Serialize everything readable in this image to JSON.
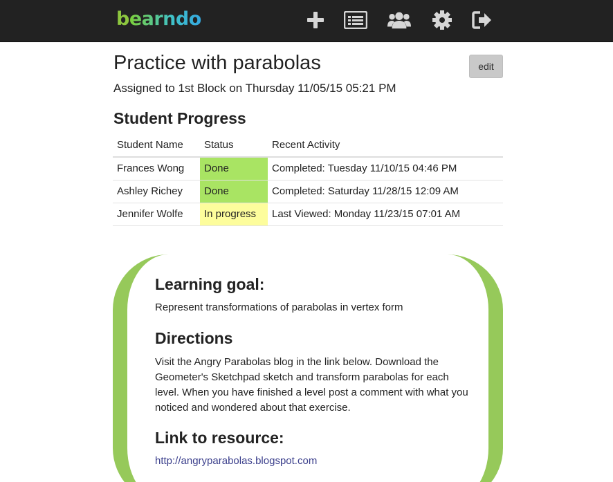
{
  "brand": {
    "logo_first": "b",
    "logo_rest": "earndo"
  },
  "nav": {
    "icons": [
      "add-icon",
      "list-icon",
      "users-icon",
      "settings-icon",
      "logout-icon"
    ]
  },
  "assignment": {
    "title": "Practice with parabolas",
    "edit_label": "edit",
    "assigned_text": "Assigned to 1st Block on Thursday 11/05/15 05:21 PM"
  },
  "progress": {
    "heading": "Student Progress",
    "columns": [
      "Student Name",
      "Status",
      "Recent Activity"
    ],
    "rows": [
      {
        "name": "Frances Wong",
        "status": "Done",
        "activity": "Completed: Tuesday 11/10/15 04:46 PM"
      },
      {
        "name": "Ashley Richey",
        "status": "Done",
        "activity": "Completed: Saturday 11/28/15 12:09 AM"
      },
      {
        "name": "Jennifer Wolfe",
        "status": "In progress",
        "activity": "Last Viewed: Monday 11/23/15 07:01 AM"
      }
    ]
  },
  "details": {
    "goal_heading": "Learning goal:",
    "goal_text": "Represent transformations of parabolas in vertex form",
    "directions_heading": "Directions",
    "directions_text": "Visit the Angry Parabolas blog in the link below. Download the Geometer's Sketchpad sketch and transform parabolas for each level. When you have finished a level post a comment with what you noticed and wondered about that exercise.",
    "link_heading": "Link to resource:",
    "link_text": "http://angryparabolas.blogspot.com"
  },
  "colors": {
    "topbar": "#222222",
    "done": "#a9e463",
    "in_progress": "#fdfd9c",
    "card_border": "#96c95a",
    "link": "#3b3f8c"
  }
}
